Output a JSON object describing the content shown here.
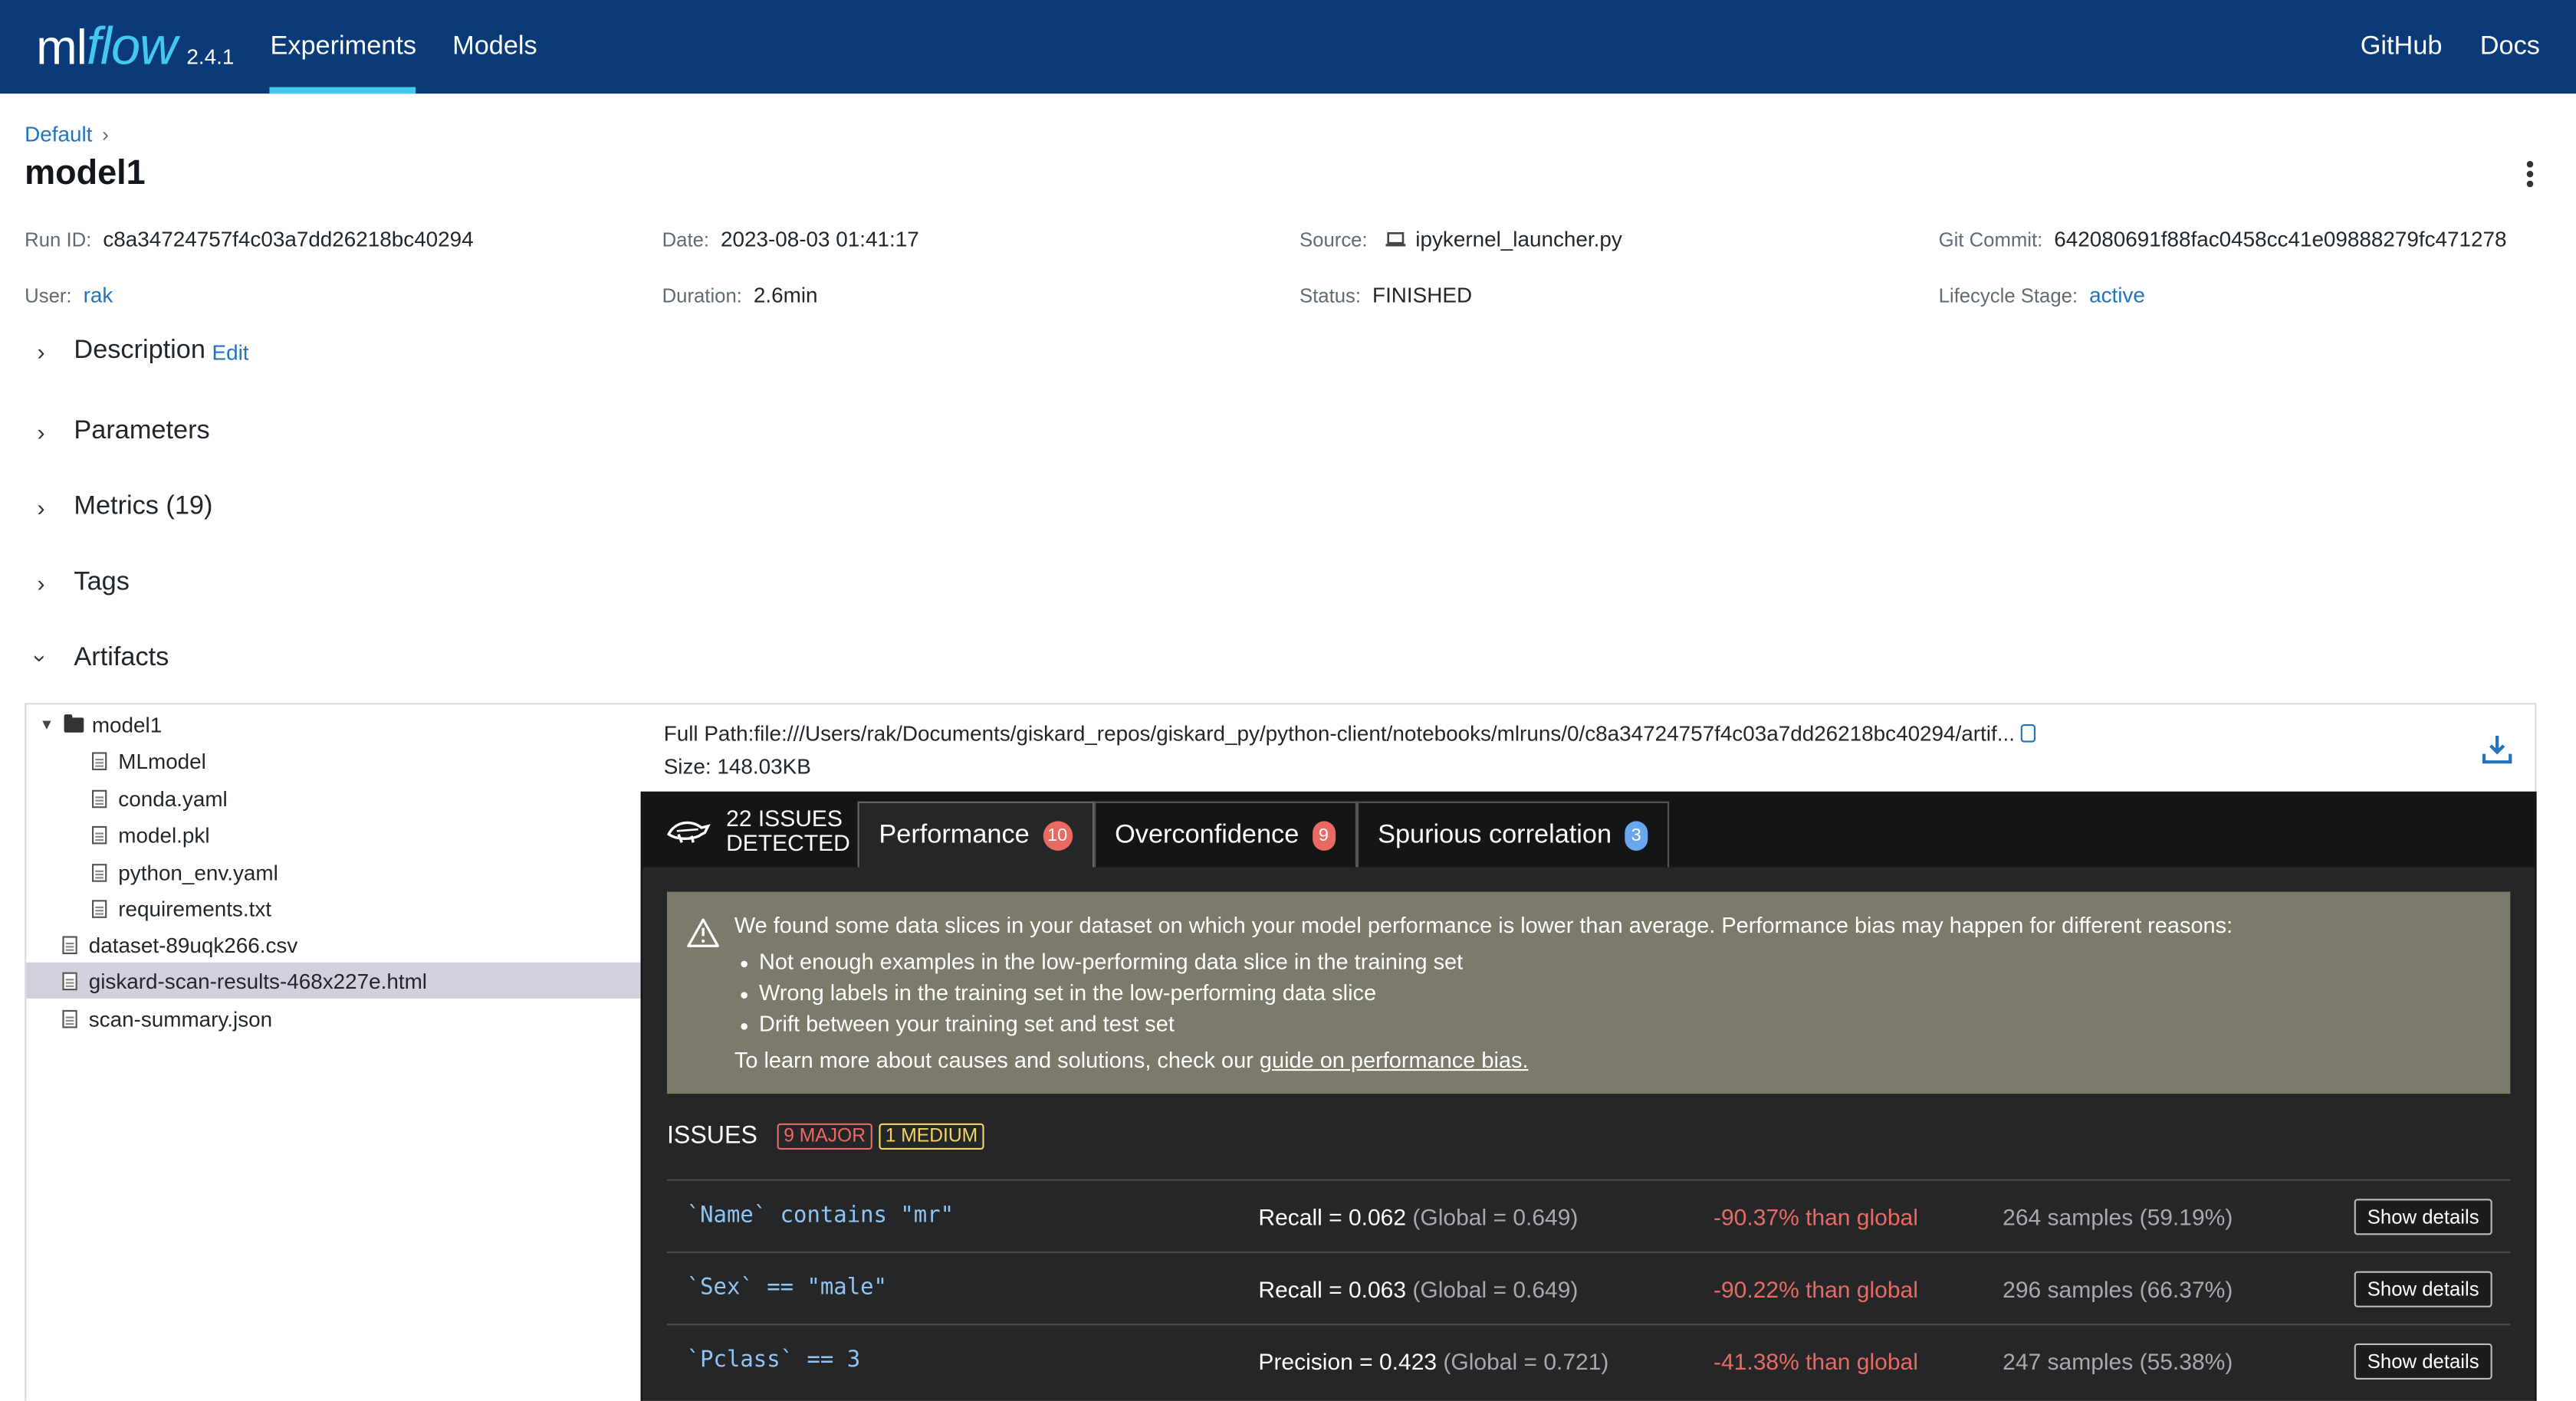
{
  "header": {
    "logo_ml": "ml",
    "logo_flow": "flow",
    "version": "2.4.1",
    "nav": [
      "Experiments",
      "Models"
    ],
    "right_links": [
      "GitHub",
      "Docs"
    ],
    "colors": {
      "bar": "#0b3a78",
      "accent": "#43c9ed"
    }
  },
  "breadcrumb": {
    "experiment": "Default",
    "sep": "›"
  },
  "run": {
    "title": "model1",
    "run_id_label": "Run ID:",
    "run_id": "c8a34724757f4c03a7dd26218bc40294",
    "date_label": "Date:",
    "date": "2023-08-03 01:41:17",
    "source_label": "Source:",
    "source": "ipykernel_launcher.py",
    "git_label": "Git Commit:",
    "git": "642080691f88fac0458cc41e09888279fc471278",
    "user_label": "User:",
    "user": "rak",
    "duration_label": "Duration:",
    "duration": "2.6min",
    "status_label": "Status:",
    "status": "FINISHED",
    "lifecycle_label": "Lifecycle Stage:",
    "lifecycle": "active"
  },
  "sections": {
    "description": "Description",
    "edit": "Edit",
    "parameters": "Parameters",
    "metrics": "Metrics (19)",
    "tags": "Tags",
    "artifacts": "Artifacts"
  },
  "tree": {
    "root": "model1",
    "children": [
      "MLmodel",
      "conda.yaml",
      "model.pkl",
      "python_env.yaml",
      "requirements.txt"
    ],
    "files": [
      "dataset-89uqk266.csv",
      "giskard-scan-results-468x227e.html",
      "scan-summary.json"
    ]
  },
  "artifact_view": {
    "full_path": "Full Path:file:///Users/rak/Documents/giskard_repos/giskard_py/python-client/notebooks/mlruns/0/c8a34724757f4c03a7dd26218bc40294/artif...",
    "size_label": "Size:",
    "size": "148.03KB"
  },
  "scan": {
    "issues_count": "22 ISSUES",
    "detected": "DETECTED",
    "tabs": [
      {
        "label": "Performance",
        "count": "10"
      },
      {
        "label": "Overconfidence",
        "count": "9"
      },
      {
        "label": "Spurious correlation",
        "count": "3"
      }
    ],
    "warning": {
      "intro": "We found some data slices in your dataset on which your model performance is lower than average. Performance bias may happen for different reasons:",
      "bullets": [
        "Not enough examples in the low-performing data slice in the training set",
        "Wrong labels in the training set in the low-performing data slice",
        "Drift between your training set and test set"
      ],
      "outro": "To learn more about causes and solutions, check our ",
      "link": "guide on performance bias."
    },
    "issues_label": "ISSUES",
    "major": "9 MAJOR",
    "medium": "1 MEDIUM",
    "rows": [
      {
        "slice": "`Name` contains \"mr\"",
        "metric": "Recall = 0.062",
        "global": "(Global = 0.649)",
        "delta": "-90.37% than global",
        "samples": "264 samples (59.19%)",
        "btn": "Show details"
      },
      {
        "slice": "`Sex` == \"male\"",
        "metric": "Recall = 0.063",
        "global": "(Global = 0.649)",
        "delta": "-90.22% than global",
        "samples": "296 samples (66.37%)",
        "btn": "Show details"
      },
      {
        "slice": "`Pclass` == 3",
        "metric": "Precision = 0.423",
        "global": "(Global = 0.721)",
        "delta": "-41.38% than global",
        "samples": "247 samples (55.38%)",
        "btn": "Show details"
      }
    ]
  }
}
